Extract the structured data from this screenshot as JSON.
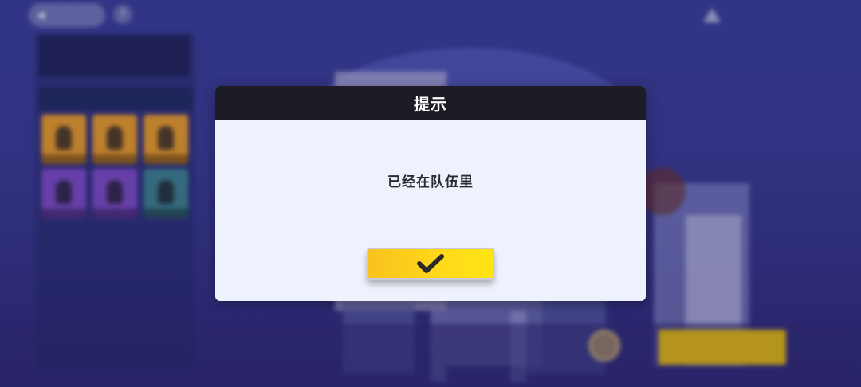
{
  "dialog": {
    "title": "提示",
    "message": "已经在队伍里",
    "confirm_icon": "checkmark-icon"
  },
  "colors": {
    "dialog_header": "#1d1b26",
    "dialog_body": "#eef2fc",
    "confirm_button_start": "#f9c21d",
    "confirm_button_end": "#ffe514",
    "checkmark": "#2a2a2a",
    "background": "#3b3f9c"
  }
}
